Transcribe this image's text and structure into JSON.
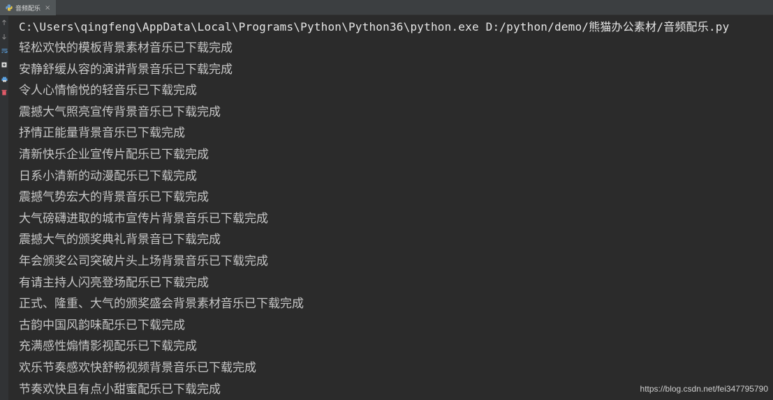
{
  "tab": {
    "title": "音频配乐",
    "close_glyph": "×",
    "icon": "python-file-icon"
  },
  "gutter": {
    "icons": [
      "arrow-up-icon",
      "arrow-down-icon",
      "soft-wrap-icon",
      "pin-tab-icon",
      "print-icon",
      "trash-icon"
    ]
  },
  "console": {
    "command": "C:\\Users\\qingfeng\\AppData\\Local\\Programs\\Python\\Python36\\python.exe D:/python/demo/熊猫办公素材/音频配乐.py",
    "lines": [
      "轻松欢快的模板背景素材音乐已下载完成",
      "安静舒缓从容的演讲背景音乐已下载完成",
      "令人心情愉悦的轻音乐已下载完成",
      "震撼大气照亮宣传背景音乐已下载完成",
      "抒情正能量背景音乐已下载完成",
      "清新快乐企业宣传片配乐已下载完成",
      "日系小清新的动漫配乐已下载完成",
      "震撼气势宏大的背景音乐已下载完成",
      "大气磅礴进取的城市宣传片背景音乐已下载完成",
      "震撼大气的颁奖典礼背景音已下载完成",
      "年会颁奖公司突破片头上场背景音乐已下载完成",
      "有请主持人闪亮登场配乐已下载完成",
      "正式、隆重、大气的颁奖盛会背景素材音乐已下载完成",
      "古韵中国风韵味配乐已下载完成",
      "充满感性煽情影视配乐已下载完成",
      "欢乐节奏感欢快舒畅视频背景音乐已下载完成",
      "节奏欢快且有点小甜蜜配乐已下载完成"
    ]
  },
  "watermark": "https://blog.csdn.net/fei347795790",
  "colors": {
    "background": "#2b2b2b",
    "command_text": "#e6e6e6",
    "output_text": "#c7c7c7"
  }
}
